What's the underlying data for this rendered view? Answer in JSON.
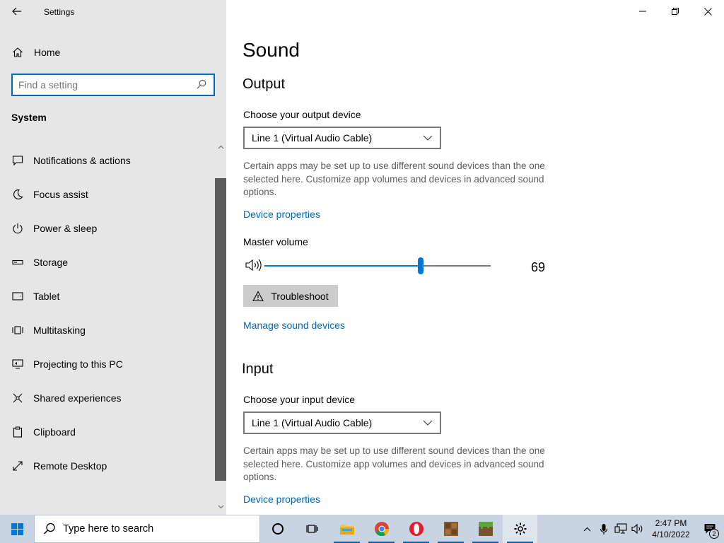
{
  "window": {
    "title": "Settings",
    "controls": [
      "minimize-icon",
      "restore-icon",
      "close-icon"
    ]
  },
  "sidebar": {
    "home_label": "Home",
    "search_placeholder": "Find a setting",
    "section": "System",
    "items": [
      {
        "label": "Notifications & actions",
        "icon": "notifications-icon"
      },
      {
        "label": "Focus assist",
        "icon": "moon-icon"
      },
      {
        "label": "Power & sleep",
        "icon": "power-icon"
      },
      {
        "label": "Storage",
        "icon": "storage-icon"
      },
      {
        "label": "Tablet",
        "icon": "tablet-icon"
      },
      {
        "label": "Multitasking",
        "icon": "multitasking-icon"
      },
      {
        "label": "Projecting to this PC",
        "icon": "projecting-icon"
      },
      {
        "label": "Shared experiences",
        "icon": "shared-experiences-icon"
      },
      {
        "label": "Clipboard",
        "icon": "clipboard-icon"
      },
      {
        "label": "Remote Desktop",
        "icon": "remote-desktop-icon"
      }
    ]
  },
  "main": {
    "title": "Sound",
    "output": {
      "heading": "Output",
      "device_label": "Choose your output device",
      "device_value": "Line 1 (Virtual Audio Cable)",
      "description": "Certain apps may be set up to use different sound devices than the one selected here. Customize app volumes and devices in advanced sound options.",
      "device_properties_link": "Device properties",
      "volume_label": "Master volume",
      "volume_value": "69",
      "volume_level": 0.69,
      "troubleshoot_label": "Troubleshoot",
      "manage_link": "Manage sound devices"
    },
    "input": {
      "heading": "Input",
      "device_label": "Choose your input device",
      "device_value": "Line 1 (Virtual Audio Cable)",
      "description": "Certain apps may be set up to use different sound devices than the one selected here. Customize app volumes and devices in advanced sound options.",
      "device_properties_link": "Device properties"
    }
  },
  "taskbar": {
    "search_placeholder": "Type here to search",
    "apps": [
      "cortana-icon",
      "task-view-icon",
      "file-explorer-icon",
      "chrome-icon",
      "opera-icon",
      "minecraft-launcher-icon",
      "minecraft-icon",
      "settings-icon"
    ],
    "time": "2:47 PM",
    "date": "4/10/2022",
    "notification_count": "2"
  }
}
